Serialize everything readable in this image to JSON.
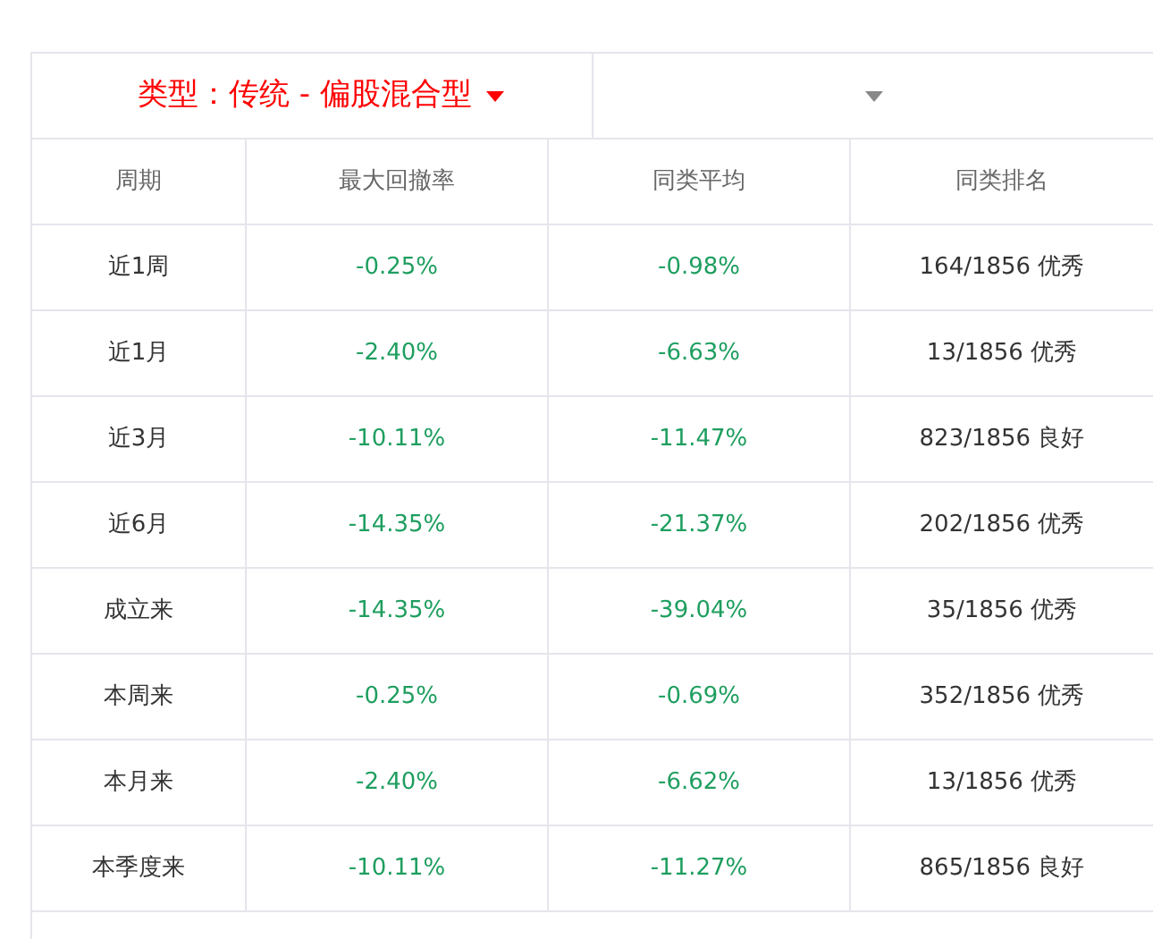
{
  "filters": [
    {
      "label": "类型：传统 - 偏股混合型",
      "active": true
    },
    {
      "active": false
    }
  ],
  "table": {
    "columns": [
      "周期",
      "最大回撤率",
      "同类平均",
      "同类排名"
    ],
    "rows": [
      [
        "近1周",
        "-0.25%",
        "-0.98%",
        "164/1856 优秀"
      ],
      [
        "近1月",
        "-2.40%",
        "-6.63%",
        "13/1856 优秀"
      ],
      [
        "近3月",
        "-10.11%",
        "-11.47%",
        "823/1856 良好"
      ],
      [
        "近6月",
        "-14.35%",
        "-21.37%",
        "202/1856 优秀"
      ],
      [
        "成立来",
        "-14.35%",
        "-39.04%",
        "35/1856 优秀"
      ],
      [
        "本周来",
        "-0.25%",
        "-0.69%",
        "352/1856 优秀"
      ],
      [
        "本月来",
        "-2.40%",
        "-6.62%",
        "13/1856 优秀"
      ],
      [
        "本季度来",
        "-10.11%",
        "-11.27%",
        "865/1856 良好"
      ]
    ]
  }
}
